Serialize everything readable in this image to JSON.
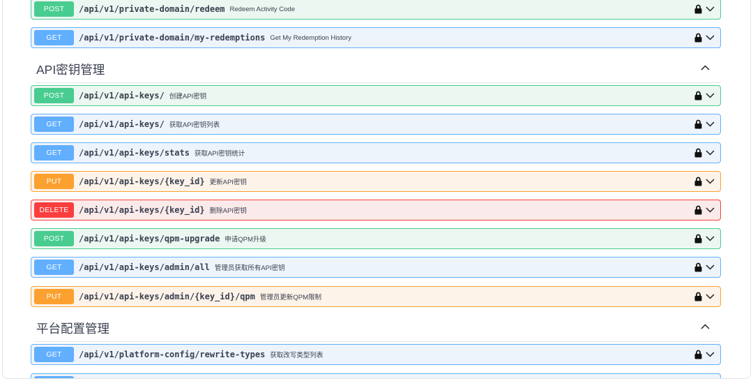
{
  "sections": [
    {
      "id": "top",
      "operations": [
        {
          "method": "POST",
          "path": "/api/v1/private-domain/redeem",
          "summary": "Redeem Activity Code"
        },
        {
          "method": "GET",
          "path": "/api/v1/private-domain/my-redemptions",
          "summary": "Get My Redemption History"
        }
      ]
    },
    {
      "id": "api-keys",
      "title": "API密钥管理",
      "operations": [
        {
          "method": "POST",
          "path": "/api/v1/api-keys/",
          "summary": "创建API密钥"
        },
        {
          "method": "GET",
          "path": "/api/v1/api-keys/",
          "summary": "获取API密钥列表"
        },
        {
          "method": "GET",
          "path": "/api/v1/api-keys/stats",
          "summary": "获取API密钥统计"
        },
        {
          "method": "PUT",
          "path": "/api/v1/api-keys/{key_id}",
          "summary": "更新API密钥"
        },
        {
          "method": "DELETE",
          "path": "/api/v1/api-keys/{key_id}",
          "summary": "删除API密钥"
        },
        {
          "method": "POST",
          "path": "/api/v1/api-keys/qpm-upgrade",
          "summary": "申请QPM升级"
        },
        {
          "method": "GET",
          "path": "/api/v1/api-keys/admin/all",
          "summary": "管理员获取所有API密钥"
        },
        {
          "method": "PUT",
          "path": "/api/v1/api-keys/admin/{key_id}/qpm",
          "summary": "管理员更新QPM限制"
        }
      ]
    },
    {
      "id": "platform-config",
      "title": "平台配置管理",
      "operations": [
        {
          "method": "GET",
          "path": "/api/v1/platform-config/rewrite-types",
          "summary": "获取改写类型列表"
        },
        {
          "method": "GET",
          "path": "",
          "summary": ""
        }
      ]
    }
  ],
  "icons": {
    "lock": "lock-icon",
    "expand": "chevron-down-icon",
    "collapse": "chevron-up-icon"
  },
  "colors": {
    "post": "#49cc90",
    "get": "#61affe",
    "put": "#fca130",
    "delete": "#f93e3e",
    "text": "#3b4151"
  }
}
